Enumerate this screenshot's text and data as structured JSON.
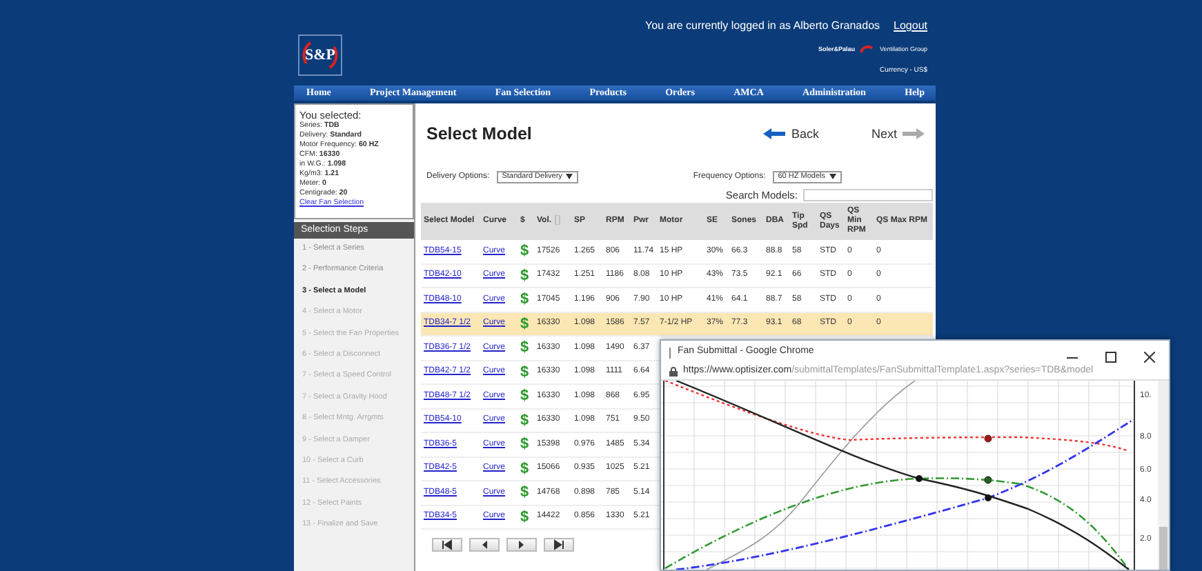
{
  "header": {
    "login_text": "You are currently logged in as Alberto Granados",
    "logout": "Logout",
    "logo_text": "S&P",
    "brand_name": "Soler&Palau",
    "brand_tagline": "Ventilation Group",
    "currency": "Currency - US$"
  },
  "nav": [
    "Home",
    "Project Management",
    "Fan Selection",
    "Products",
    "Orders",
    "AMCA",
    "Administration",
    "Help"
  ],
  "selection": {
    "title": "You selected:",
    "lines": [
      "Series: **TDB**",
      "Delivery: **Standard**",
      "Motor Frequency: **60 HZ**",
      "CFM: **16330**",
      "in W.G.: **1.098**",
      "Kg/m3: **1.21**",
      "Meter: **0**",
      "Centigrade: **20**"
    ],
    "clear_link": "Clear Fan Selection"
  },
  "steps_title": "Selection Steps",
  "steps": [
    {
      "label": "1 - Select a Series",
      "selected": false,
      "disabled": false
    },
    {
      "label": "2 - Performance Criteria",
      "selected": false,
      "disabled": false
    },
    {
      "label": "3 - Select a Model",
      "selected": true,
      "disabled": false
    },
    {
      "label": "4 - Select a Motor",
      "selected": false,
      "disabled": true
    },
    {
      "label": "5 - Select the Fan Properties",
      "selected": false,
      "disabled": true
    },
    {
      "label": "6 - Select a Disconnect",
      "selected": false,
      "disabled": true
    },
    {
      "label": "7 - Select a Speed Control",
      "selected": false,
      "disabled": true
    },
    {
      "label": "7 - Select a Gravity Hood",
      "selected": false,
      "disabled": true
    },
    {
      "label": "8 - Select Mntg. Arrgmts",
      "selected": false,
      "disabled": true
    },
    {
      "label": "9 - Select a Damper",
      "selected": false,
      "disabled": true
    },
    {
      "label": "10 - Select a Curb",
      "selected": false,
      "disabled": true
    },
    {
      "label": "11 - Select Accessories",
      "selected": false,
      "disabled": true
    },
    {
      "label": "12 - Select Paints",
      "selected": false,
      "disabled": true
    },
    {
      "label": "13 - Finalize and Save",
      "selected": false,
      "disabled": true
    }
  ],
  "page_title": "Select Model",
  "back": "Back",
  "next": "Next",
  "delivery": {
    "label": "Delivery Options:",
    "value": "Standard Delivery"
  },
  "frequency": {
    "label": "Frequency Options:",
    "value": "60 HZ Models"
  },
  "search": {
    "label": "Search Models:"
  },
  "table": {
    "columns": [
      "Select Model",
      "Curve",
      "$",
      "Vol.",
      "SP",
      "RPM",
      "Pwr",
      "Motor",
      "SE",
      "Sones",
      "DBA",
      "Tip Spd",
      "QS Days",
      "QS Min RPM",
      "QS Max RPM"
    ],
    "rows": [
      {
        "selected": false,
        "cells": [
          "TDB54-15",
          "Curve",
          "$",
          "17526",
          "1.265",
          "806",
          "11.74",
          "15 HP",
          "30%",
          "66.3",
          "88.8",
          "58",
          "STD",
          "0",
          "0"
        ]
      },
      {
        "selected": false,
        "cells": [
          "TDB42-10",
          "Curve",
          "$",
          "17432",
          "1.251",
          "1186",
          "8.08",
          "10 HP",
          "43%",
          "73.5",
          "92.1",
          "66",
          "STD",
          "0",
          "0"
        ]
      },
      {
        "selected": false,
        "cells": [
          "TDB48-10",
          "Curve",
          "$",
          "17045",
          "1.196",
          "906",
          "7.90",
          "10 HP",
          "41%",
          "64.1",
          "88.7",
          "58",
          "STD",
          "0",
          "0"
        ]
      },
      {
        "selected": true,
        "cells": [
          "TDB34-7 1/2",
          "Curve",
          "$",
          "16330",
          "1.098",
          "1586",
          "7.57",
          "7-1/2 HP",
          "37%",
          "77.3",
          "93.1",
          "68",
          "STD",
          "0",
          "0"
        ]
      },
      {
        "selected": false,
        "cells": [
          "TDB36-7 1/2",
          "Curve",
          "$",
          "16330",
          "1.098",
          "1490",
          "6.37"
        ]
      },
      {
        "selected": false,
        "cells": [
          "TDB42-7 1/2",
          "Curve",
          "$",
          "16330",
          "1.098",
          "1111",
          "6.64"
        ]
      },
      {
        "selected": false,
        "cells": [
          "TDB48-7 1/2",
          "Curve",
          "$",
          "16330",
          "1.098",
          "868",
          "6.95"
        ]
      },
      {
        "selected": false,
        "cells": [
          "TDB54-10",
          "Curve",
          "$",
          "16330",
          "1.098",
          "751",
          "9.50"
        ]
      },
      {
        "selected": false,
        "cells": [
          "TDB36-5",
          "Curve",
          "$",
          "15398",
          "0.976",
          "1485",
          "5.34"
        ]
      },
      {
        "selected": false,
        "cells": [
          "TDB42-5",
          "Curve",
          "$",
          "15066",
          "0.935",
          "1025",
          "5.21"
        ]
      },
      {
        "selected": false,
        "cells": [
          "TDB48-5",
          "Curve",
          "$",
          "14768",
          "0.898",
          "785",
          "5.14"
        ]
      },
      {
        "selected": false,
        "cells": [
          "TDB34-5",
          "Curve",
          "$",
          "14422",
          "0.856",
          "1330",
          "5.21"
        ]
      }
    ]
  },
  "pager": [
    {
      "kind": "first"
    },
    {
      "kind": "prev"
    },
    {
      "kind": "next"
    },
    {
      "kind": "last"
    }
  ],
  "popup": {
    "title": "Fan Submittal - Google Chrome",
    "url_host": "https://www.optisizer.com",
    "url_path": "/submittalTemplates/FanSubmittalTemplate1.aspx?series=TDB&model",
    "y_ticks": [
      "10.",
      "8.0",
      "6.0",
      "4.0",
      "2.0"
    ]
  }
}
